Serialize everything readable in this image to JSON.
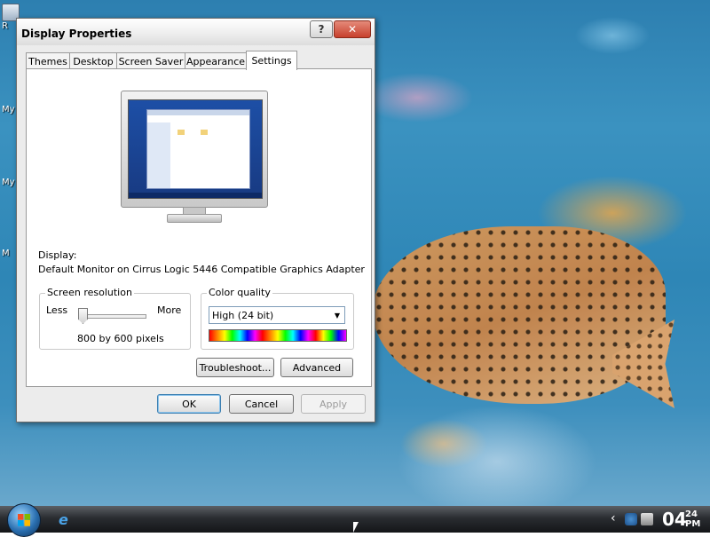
{
  "desktop": {
    "icon_labels": [
      "R",
      "My",
      "My",
      "M"
    ]
  },
  "dialog": {
    "title": "Display Properties",
    "help_label": "?",
    "close_label": "✕",
    "tabs": [
      {
        "label": "Themes",
        "active": false
      },
      {
        "label": "Desktop",
        "active": false
      },
      {
        "label": "Screen Saver",
        "active": false
      },
      {
        "label": "Appearance",
        "active": false
      },
      {
        "label": "Settings",
        "active": true
      }
    ],
    "display_label": "Display:",
    "display_value": "Default Monitor on Cirrus Logic 5446 Compatible Graphics Adapter",
    "resolution": {
      "group_title": "Screen resolution",
      "less_label": "Less",
      "more_label": "More",
      "value_text": "800 by 600 pixels",
      "slider_position": 0.0
    },
    "color_quality": {
      "group_title": "Color quality",
      "selected": "High (24 bit)"
    },
    "troubleshoot_label": "Troubleshoot...",
    "advanced_label": "Advanced",
    "ok_label": "OK",
    "cancel_label": "Cancel",
    "apply_label": "Apply"
  },
  "taskbar": {
    "clock_hour": "04",
    "clock_minute": "24",
    "clock_ampm": "PM",
    "tray_chevron": "‹"
  },
  "colors": {
    "accent": "#3c7fb1",
    "close_button": "#c7402c"
  }
}
